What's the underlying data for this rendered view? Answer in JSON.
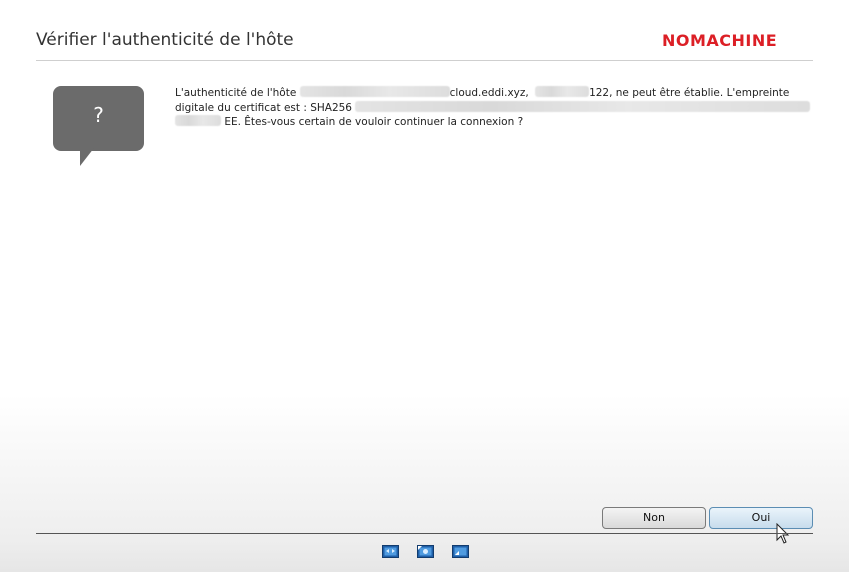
{
  "dialog": {
    "title": "Vérifier l'authenticité de l'hôte",
    "brand": "NOMACHINE",
    "question_symbol": "?"
  },
  "message": {
    "line1_prefix": "L'authenticité de l'hôte ",
    "line1_host_suffix": "cloud.eddi.xyz,",
    "line1_ip_suffix": "122, ne peut être établie. L'empreinte",
    "line2_prefix": "digitale du certificat est : SHA256",
    "line3_suffix": "EE. Êtes-vous certain de vouloir continuer la connexion ?"
  },
  "buttons": {
    "no_label": "Non",
    "yes_label": "Oui"
  },
  "colors": {
    "brand": "#dc1f26",
    "bubble": "#6b6b6b",
    "default_button_border": "#5b8db3"
  },
  "taskbar_icons": [
    "display-icon",
    "display-settings-icon",
    "window-icon"
  ]
}
